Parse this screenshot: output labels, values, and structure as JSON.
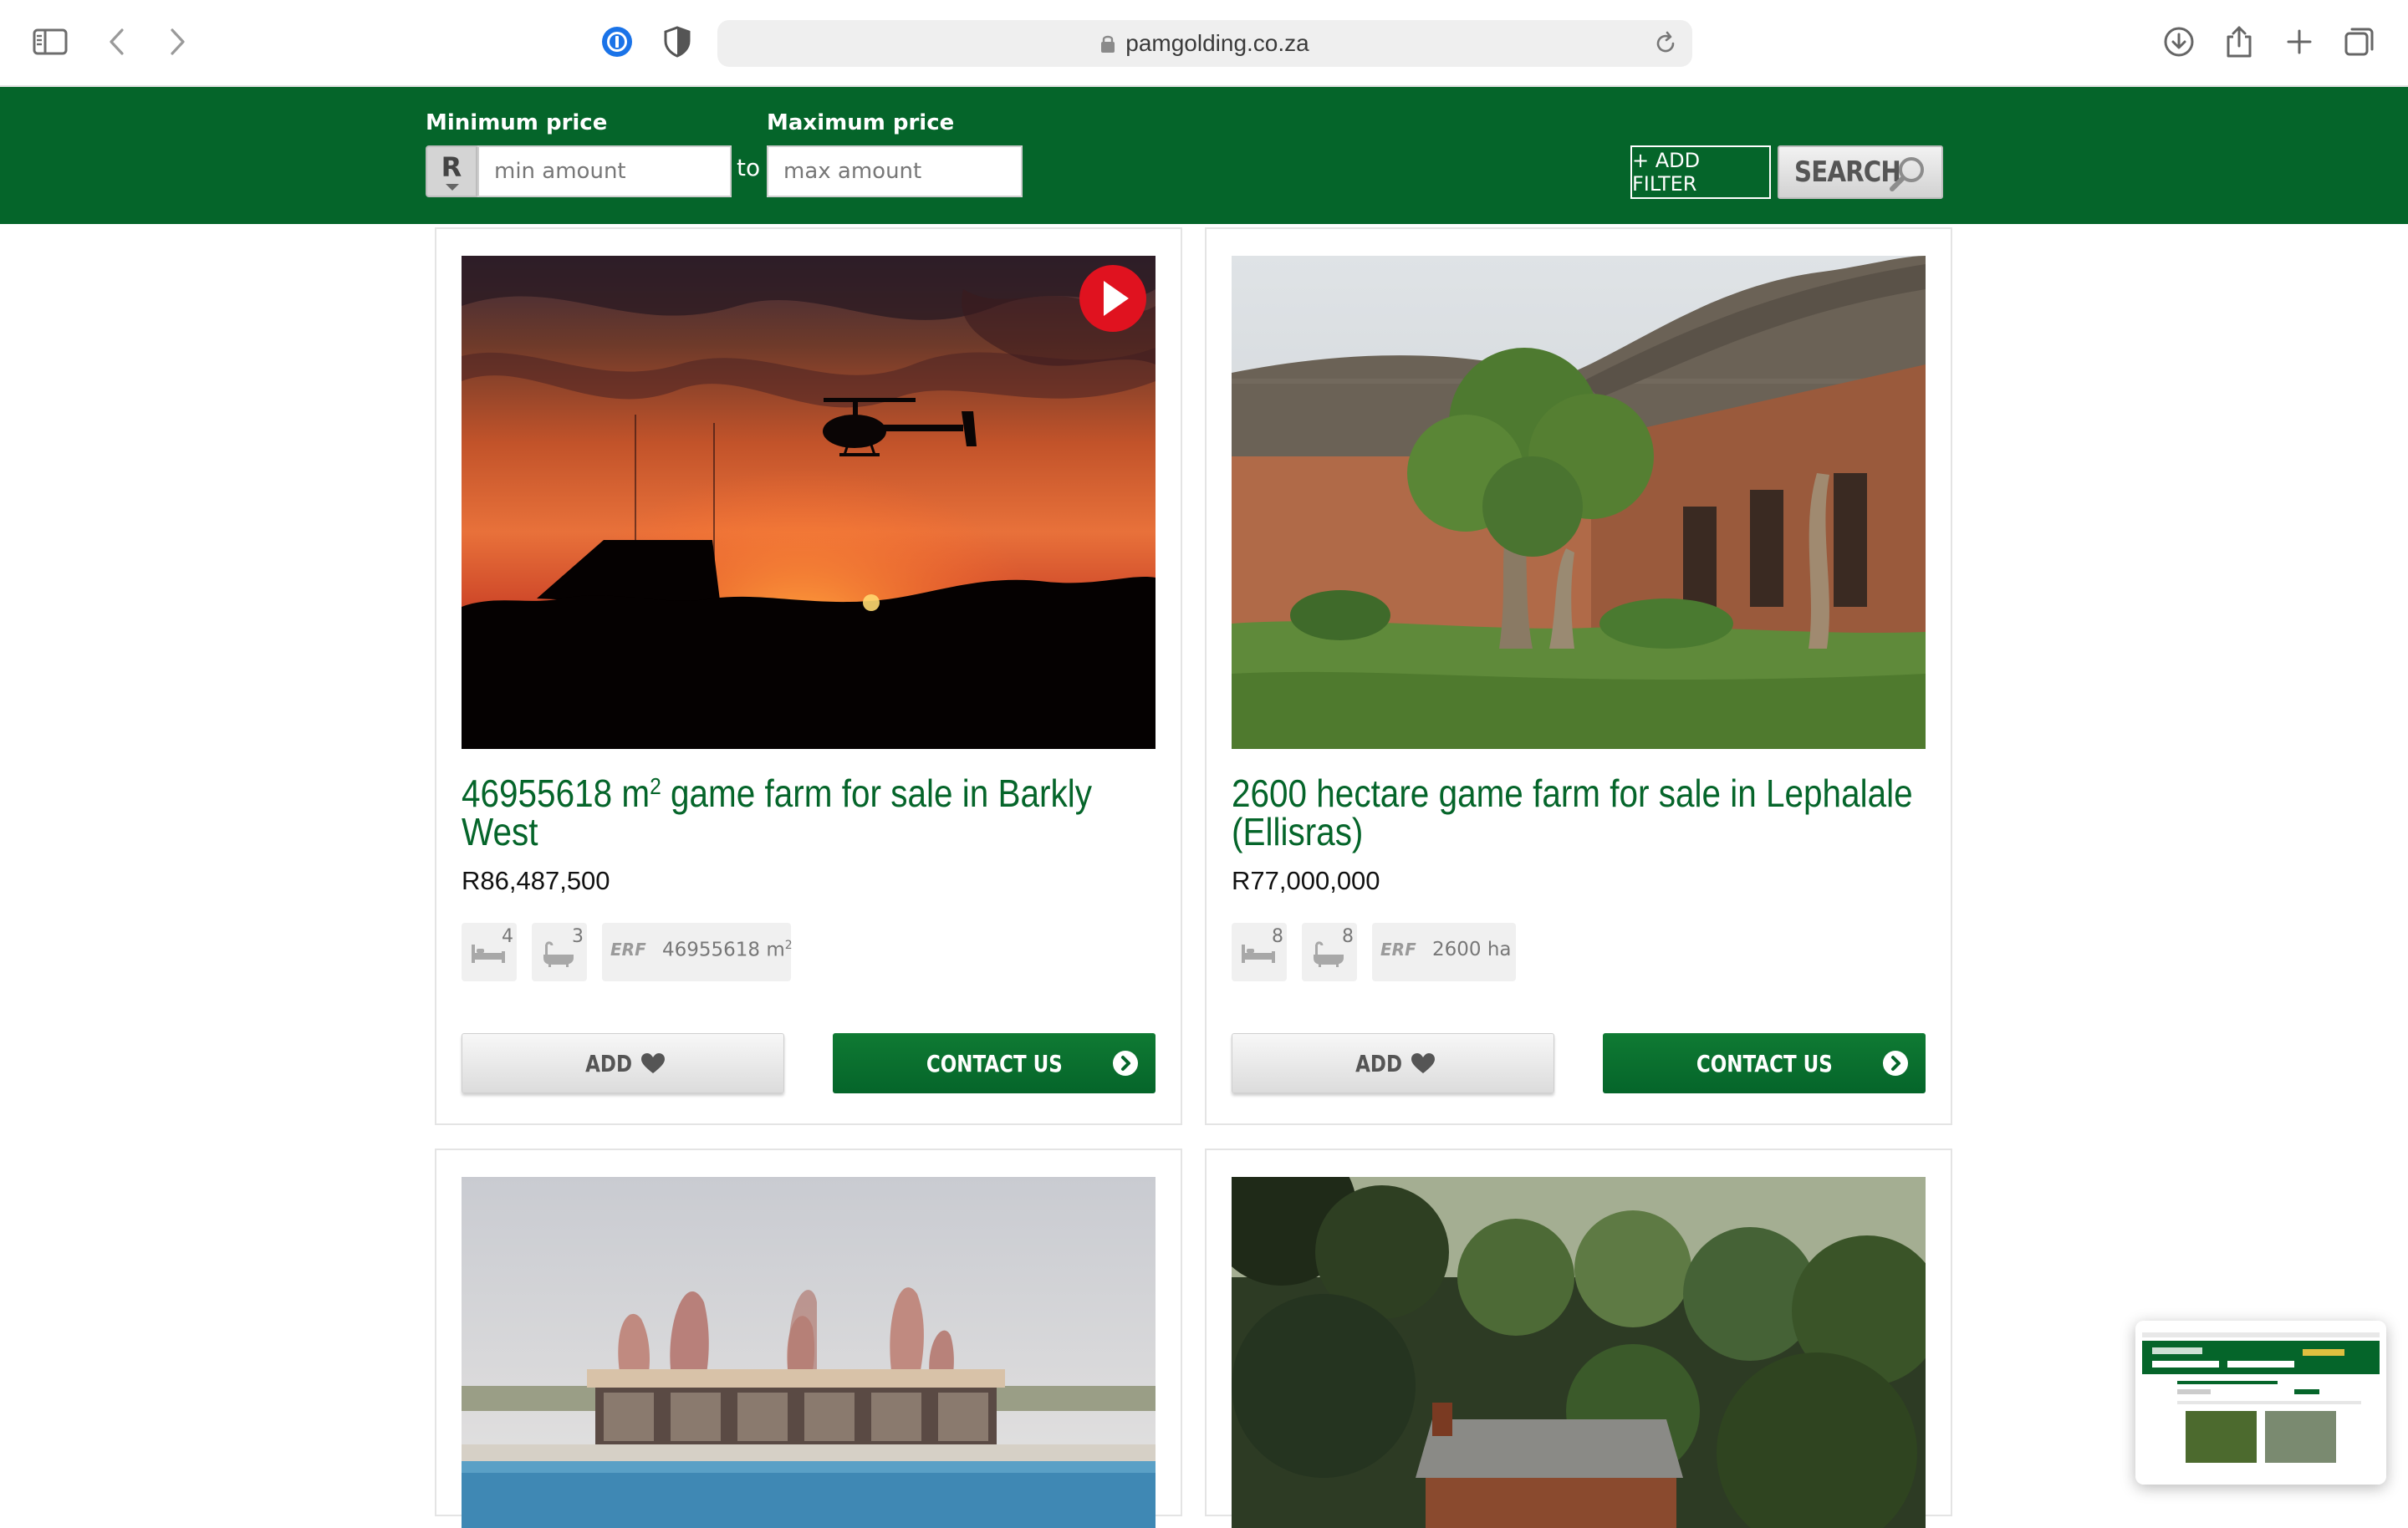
{
  "browser": {
    "url": "pamgolding.co.za"
  },
  "filters": {
    "min_label": "Minimum price",
    "max_label": "Maximum price",
    "currency": "R",
    "min_placeholder": "min amount",
    "max_placeholder": "max amount",
    "to_label": "to",
    "add_filter_label": "+ ADD FILTER",
    "search_label": "SEARCH"
  },
  "listings": [
    {
      "title": "46955618 m",
      "title_sup": "2",
      "title_rest": " game farm for sale in Barkly West",
      "price": "R86,487,500",
      "bedrooms": "4",
      "bathrooms": "3",
      "erf_label": "ERF",
      "erf_value": "46955618 m",
      "erf_sup": "2",
      "add_label": "ADD",
      "contact_label": "CONTACT US",
      "has_video": true
    },
    {
      "title": "2600 hectare game farm for sale in Lephalale (Ellisras)",
      "title_sup": "",
      "title_rest": "",
      "price": "R77,000,000",
      "bedrooms": "8",
      "bathrooms": "8",
      "erf_label": "ERF",
      "erf_value": "2600 ha",
      "erf_sup": "",
      "add_label": "ADD",
      "contact_label": "CONTACT US",
      "has_video": false
    }
  ],
  "colors": {
    "brand_green": "#05652a",
    "video_red": "#e0121f"
  }
}
